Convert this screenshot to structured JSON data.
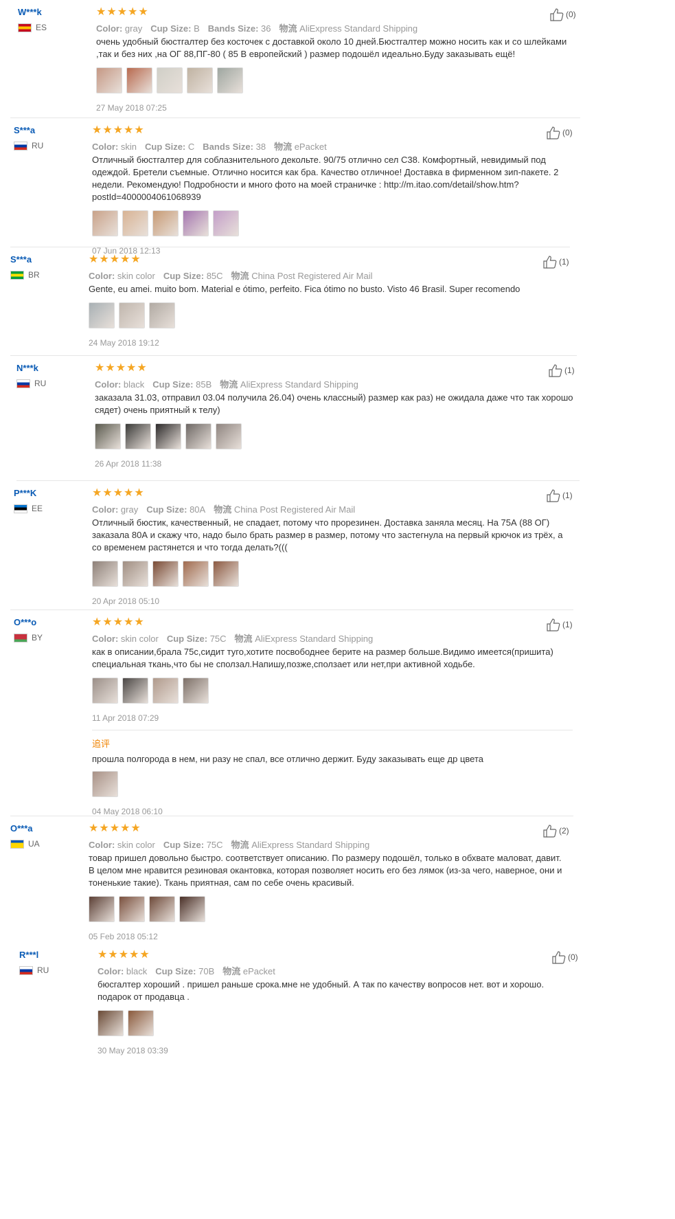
{
  "labels": {
    "color": "Color:",
    "cup": "Cup Size:",
    "bands": "Bands Size:",
    "logistics": "物流",
    "followup": "追评"
  },
  "reviews": [
    {
      "user": "W***k",
      "country": "ES",
      "flag_colors": [
        "#c60b1e",
        "#ffc400",
        "#c60b1e"
      ],
      "stars": "★★★★★",
      "color": "gray",
      "cup": "B",
      "bands": "36",
      "shipping": "AliExpress Standard Shipping",
      "text": "очень удобный бюстгалтер без косточек с доставкой около 10 дней.Бюстгалтер можно носить как и со шлейками ,так и без них ,на ОГ 88,ПГ-80 ( 85 B европейский ) размер подошёл идеально.Буду заказывать ещё!",
      "thumb_colors": [
        "#c59884",
        "#b86a4f",
        "#d0cfc7",
        "#c0b3a2",
        "#9ea6a0"
      ],
      "date": "27 May 2018 07:25",
      "likes": "(0)"
    },
    {
      "user": "S***a",
      "country": "RU",
      "flag_colors": [
        "#ffffff",
        "#0039a6",
        "#d52b1e"
      ],
      "stars": "★★★★★",
      "color": "skin",
      "cup": "C",
      "bands": "38",
      "shipping": "ePacket",
      "text": "Отличный бюстгалтер для соблазнительного декольте. 90/75 отлично сел С38. Комфортный, невидимый под одеждой. Бретели съемные. Отлично носится как бра. Качество отличное! Доставка в фирменном зип-пакете. 2 недели. Рекомендую! Подробности и много фото на моей страничке : http://m.itao.com/detail/show.htm?postId=4000004061068939",
      "thumb_colors": [
        "#c9a289",
        "#d8b394",
        "#c79a74",
        "#a577b0",
        "#c39ec8"
      ],
      "date": "07 Jun 2018 12:13",
      "likes": "(0)"
    },
    {
      "user": "S***a",
      "country": "BR",
      "flag_colors": [
        "#009c3b",
        "#ffdf00",
        "#009c3b"
      ],
      "stars": "★★★★★",
      "color": "skin color",
      "cup": "85C",
      "bands": "",
      "shipping": "China Post Registered Air Mail",
      "text": "Gente, eu amei. muito bom. Material e ótimo, perfeito. Fica ótimo no busto. Visto 46 Brasil. Super recomendo",
      "thumb_colors": [
        "#a8b0b4",
        "#c0b6ad",
        "#b1aaa3"
      ],
      "date": "24 May 2018 19:12",
      "likes": "(1)"
    },
    {
      "user": "N***k",
      "country": "RU",
      "flag_colors": [
        "#ffffff",
        "#0039a6",
        "#d52b1e"
      ],
      "stars": "★★★★★",
      "color": "black",
      "cup": "85B",
      "bands": "",
      "shipping": "AliExpress Standard Shipping",
      "text": "заказала 31.03, отправил 03.04 получила 26.04) очень классный) размер как раз) не ожидала даже что так хорошо сядет) очень приятный к телу)",
      "thumb_colors": [
        "#5a5a4e",
        "#3a3a38",
        "#2c2a2a",
        "#6e6865",
        "#8f8580"
      ],
      "date": "26 Apr 2018 11:38",
      "likes": "(1)"
    },
    {
      "user": "P***K",
      "country": "EE",
      "flag_colors": [
        "#0072ce",
        "#000000",
        "#ffffff"
      ],
      "stars": "★★★★★",
      "color": "gray",
      "cup": "80A",
      "bands": "",
      "shipping": "China Post Registered Air Mail",
      "text": "Отличный бюстик, качественный, не спадает, потому что прорезинен. Доставка заняла месяц. На 75А (88 ОГ) заказала 80А и скажу что, надо было брать размер в размер, потому что застегнула на первый крючок из трёх, а со временем растянется и что тогда делать?(((",
      "thumb_colors": [
        "#8e8078",
        "#a08e82",
        "#7a4b35",
        "#a06a4e",
        "#8c5a42"
      ],
      "date": "20 Apr 2018 05:10",
      "likes": "(1)"
    },
    {
      "user": "O***o",
      "country": "BY",
      "flag_colors": [
        "#c8313e",
        "#c8313e",
        "#4aa657"
      ],
      "stars": "★★★★★",
      "color": "skin color",
      "cup": "75C",
      "bands": "",
      "shipping": "AliExpress Standard Shipping",
      "text": "как в описании,брала 75с,сидит туго,хотите посвободнее берите на размер больше.Видимо имеется(пришита) специальная ткань,что бы не сползал.Напишу,позже,сползает или нет,при активной ходьбе.",
      "thumb_colors": [
        "#9b8f88",
        "#4b4745",
        "#b09a8c",
        "#7d7068"
      ],
      "date": "11 Apr 2018 07:29",
      "likes": "(1)",
      "followup": {
        "text": "прошла полгорода в нем, ни разу не спал, все отлично держит. Буду заказывать еще др цвета",
        "thumb_colors": [
          "#a89186"
        ],
        "date": "04 May 2018 06:10"
      }
    },
    {
      "user": "O***a",
      "country": "UA",
      "flag_colors": [
        "#0057b7",
        "#ffd700",
        "#ffd700"
      ],
      "stars": "★★★★★",
      "color": "skin color",
      "cup": "75C",
      "bands": "",
      "shipping": "AliExpress Standard Shipping",
      "text": "товар пришел довольно быстро. соответствует описанию. По размеру подошёл, только в обхвате маловат, давит. В целом мне нравится резиновая окантовка, которая позволяет носить его без лямок (из-за чего, наверное, они и тоненькие такие). Ткань приятная, сам по себе очень красивый.",
      "thumb_colors": [
        "#5c4036",
        "#7a503e",
        "#6e4a3a",
        "#4a3028"
      ],
      "date": "05 Feb 2018 05:12",
      "likes": "(2)"
    },
    {
      "user": "R***l",
      "country": "RU",
      "flag_colors": [
        "#ffffff",
        "#0039a6",
        "#d52b1e"
      ],
      "stars": "★★★★★",
      "color": "black",
      "cup": "70B",
      "bands": "",
      "shipping": "ePacket",
      "text": "бюсгалтер хороший . пришел раньше срока.мне не удобный. А так по качеству вопросов нет. вот и хорошо. подарок от продавца .",
      "thumb_colors": [
        "#6a4a36",
        "#8a5a3c"
      ],
      "date": "30 May 2018 03:39",
      "likes": "(0)"
    }
  ]
}
